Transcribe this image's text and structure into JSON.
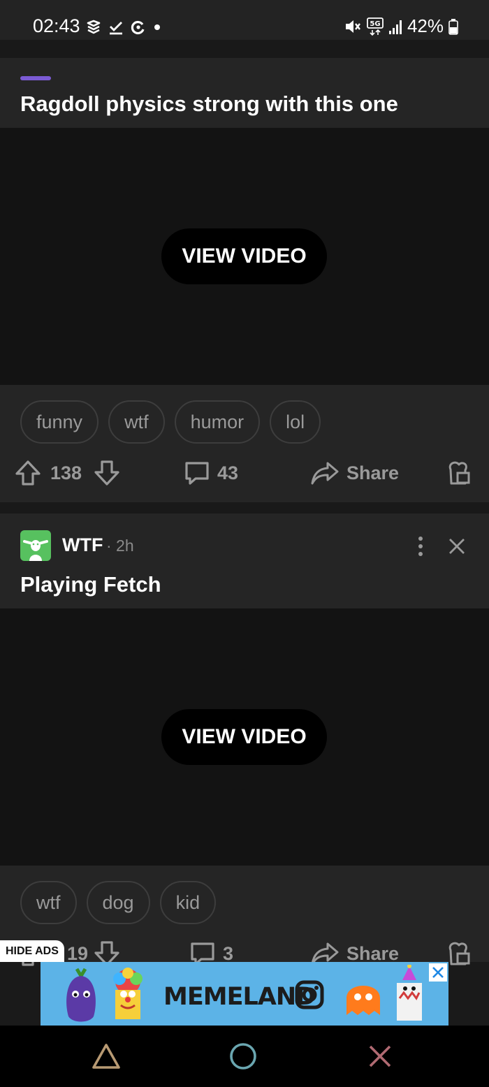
{
  "status_bar": {
    "time": "02:43",
    "battery": "42%",
    "network": "5G"
  },
  "post1": {
    "title": "Ragdoll physics strong with this one",
    "video_button": "VIEW VIDEO",
    "tags": [
      "funny",
      "wtf",
      "humor",
      "lol"
    ],
    "upvotes": "138",
    "comments": "43",
    "share_label": "Share"
  },
  "post2": {
    "subreddit": "WTF",
    "time": "· 2h",
    "title": "Playing Fetch",
    "video_button": "VIEW VIDEO",
    "tags": [
      "wtf",
      "dog",
      "kid"
    ],
    "upvotes": "19",
    "comments": "3",
    "share_label": "Share"
  },
  "ads": {
    "hide_label": "HIDE ADS",
    "banner_text": "MEMELAND"
  },
  "colors": {
    "accent": "#7b5bd4",
    "subreddit_avatar": "#57c15f",
    "ad_background": "#5cb3e7"
  },
  "icons": {
    "upvote": "arrow-up-icon",
    "downvote": "arrow-down-icon",
    "comment": "comment-icon",
    "share": "share-arrow-icon",
    "award": "award-icon",
    "more": "more-vertical-icon",
    "close": "close-icon",
    "nav_back": "triangle-icon",
    "nav_home": "circle-icon",
    "nav_recent": "cross-icon"
  }
}
